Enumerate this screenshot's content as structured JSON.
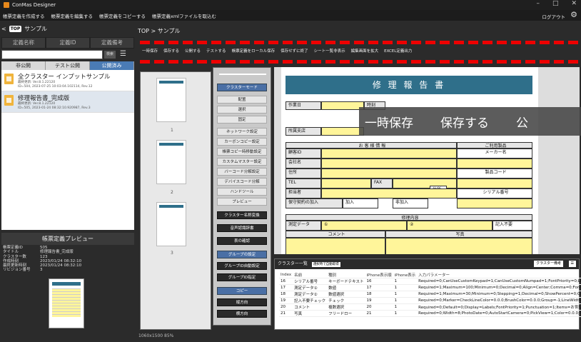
{
  "app": {
    "title": "ConMas Designer"
  },
  "menu": {
    "items": [
      "帳票定義を作成する",
      "帳票定義を編集する",
      "帳票定義をコピーする",
      "帳票定義xmlファイルを取込む"
    ],
    "logout": "ログアウト"
  },
  "left": {
    "top_label": "TOP",
    "folder": "サンプル",
    "header_tabs": [
      "定義名称",
      "定義ID",
      "定義備考"
    ],
    "search_btn": "検索",
    "pub_tabs": [
      "非公開",
      "テスト公開",
      "公開済み"
    ],
    "items": [
      {
        "title": "全クラスター インプットサンプル",
        "meta1": "最終更新: Ver.8.1.22120",
        "meta2": "ID=504, 2023-07-25 10:03:04.102114, Rev.12"
      },
      {
        "title": "修理報告書_完成版",
        "meta1": "最終更新: Ver.8.1.22120",
        "meta2": "ID=505, 2023-01-24 08:32:10.920987, Rev.3"
      }
    ],
    "preview_header": "帳票定義プレビュー",
    "props": [
      [
        "帳票定義ID",
        "505"
      ],
      [
        "タイトル",
        "修理報告書_完成版"
      ],
      [
        "クラスター数",
        "123"
      ],
      [
        "作成時刻",
        "2023/01/24 08:32:10"
      ],
      [
        "最終更新時刻",
        "2023/01/24 08:32:10"
      ],
      [
        "リビジョン番号",
        "3"
      ]
    ]
  },
  "breadcrumb": "TOP > サンプル",
  "toolbar": [
    "一時保存",
    "保存する",
    "公開する",
    "テストする",
    "帳票定義をローカル保存",
    "保存せずに終了",
    "シート一覧非表示",
    "編集画面を拡大",
    "EXCEL定義出力"
  ],
  "thumb_pages": [
    "1",
    "2",
    "3"
  ],
  "mode_buttons": [
    "クラスターモード",
    "配置",
    "選択",
    "固定",
    "ネットワーク設定",
    "カーボンコピー設定",
    "帳票コピー時移動設定",
    "カスタムマスター設定",
    "バーコード分解設定",
    "デバイスコード分解",
    "ハンドツール",
    "プレビュー",
    "クラスター名称変換",
    "音声認識辞書",
    "表の確認",
    "グループの設定",
    "グループID自動設定",
    "グループID指定",
    "コピー",
    "縦方向",
    "横方向"
  ],
  "form": {
    "title": "修 理 報 告 書",
    "work_date": "作業日",
    "time": "時刻",
    "branch": "所属支店",
    "customer_info": "お 客 様 情 報",
    "product": "ご利用製品",
    "customer_id": "顧客ID",
    "maker": "メーカー名",
    "company": "会社名",
    "address": "住所",
    "product_code": "製品コード",
    "tel": "TEL",
    "fax": "FAX",
    "staff": "担当者",
    "serial": "シリアル番号",
    "contract": "保守契約の加入",
    "join": "加入",
    "not_join": "非加入",
    "repair": "修理内容",
    "measure": "測定データ",
    "c1": "①",
    "c2": "②",
    "no_entry": "記入不要",
    "comment": "コメント",
    "photo": "写真",
    "address_btn": "住所"
  },
  "overlay": [
    "一時保存",
    "保存する",
    "公"
  ],
  "cluster_list": {
    "title": "クラスター一覧",
    "chip": "選択時で自動取得",
    "tab": "クラスター備考",
    "headers": [
      "Index",
      "名前",
      "種別",
      "iPhone表示順",
      "iPhone表示",
      "入力パラメーター"
    ],
    "rows": [
      [
        "16",
        "シリアル番号",
        "キーボードテキスト",
        "16",
        "1",
        "Required=0;CanUseCustomKeypad=1;CanUseCustomNumpad=1;FontPriority=0;Lin"
      ],
      [
        "17",
        "測定データ①",
        "数値",
        "17",
        "1",
        "Required=1;Maximum=100;Minimum=0;Decimal=0;Align=Center;Comma=0;Font="
      ],
      [
        "18",
        "測定データ②",
        "数値選択",
        "18",
        "1",
        "Required=1;Maximum=30;Minimum=0;Stepping=1;Decimal=0;ShowPercent=0;Cou"
      ],
      [
        "19",
        "記入不要チェック",
        "チェック",
        "19",
        "1",
        "Required=0;Marker=CheckLineColor=0.0.0;BrushColor=0.0.0;Group=-1;LineWidth="
      ],
      [
        "20",
        "コメント",
        "複数選択",
        "20",
        "1",
        "Required=0;Default=0;Display=Labels;FontPriority=1;Punctuation=1;Items=お世話に"
      ],
      [
        "21",
        "写真",
        "フリードロー",
        "21",
        "1",
        "Required=0;Width=8;PhotoDate=0;AutoStartCamera=0;PickView=1;Color=0.0.0;En"
      ]
    ]
  },
  "status": "1060x1500 85%"
}
